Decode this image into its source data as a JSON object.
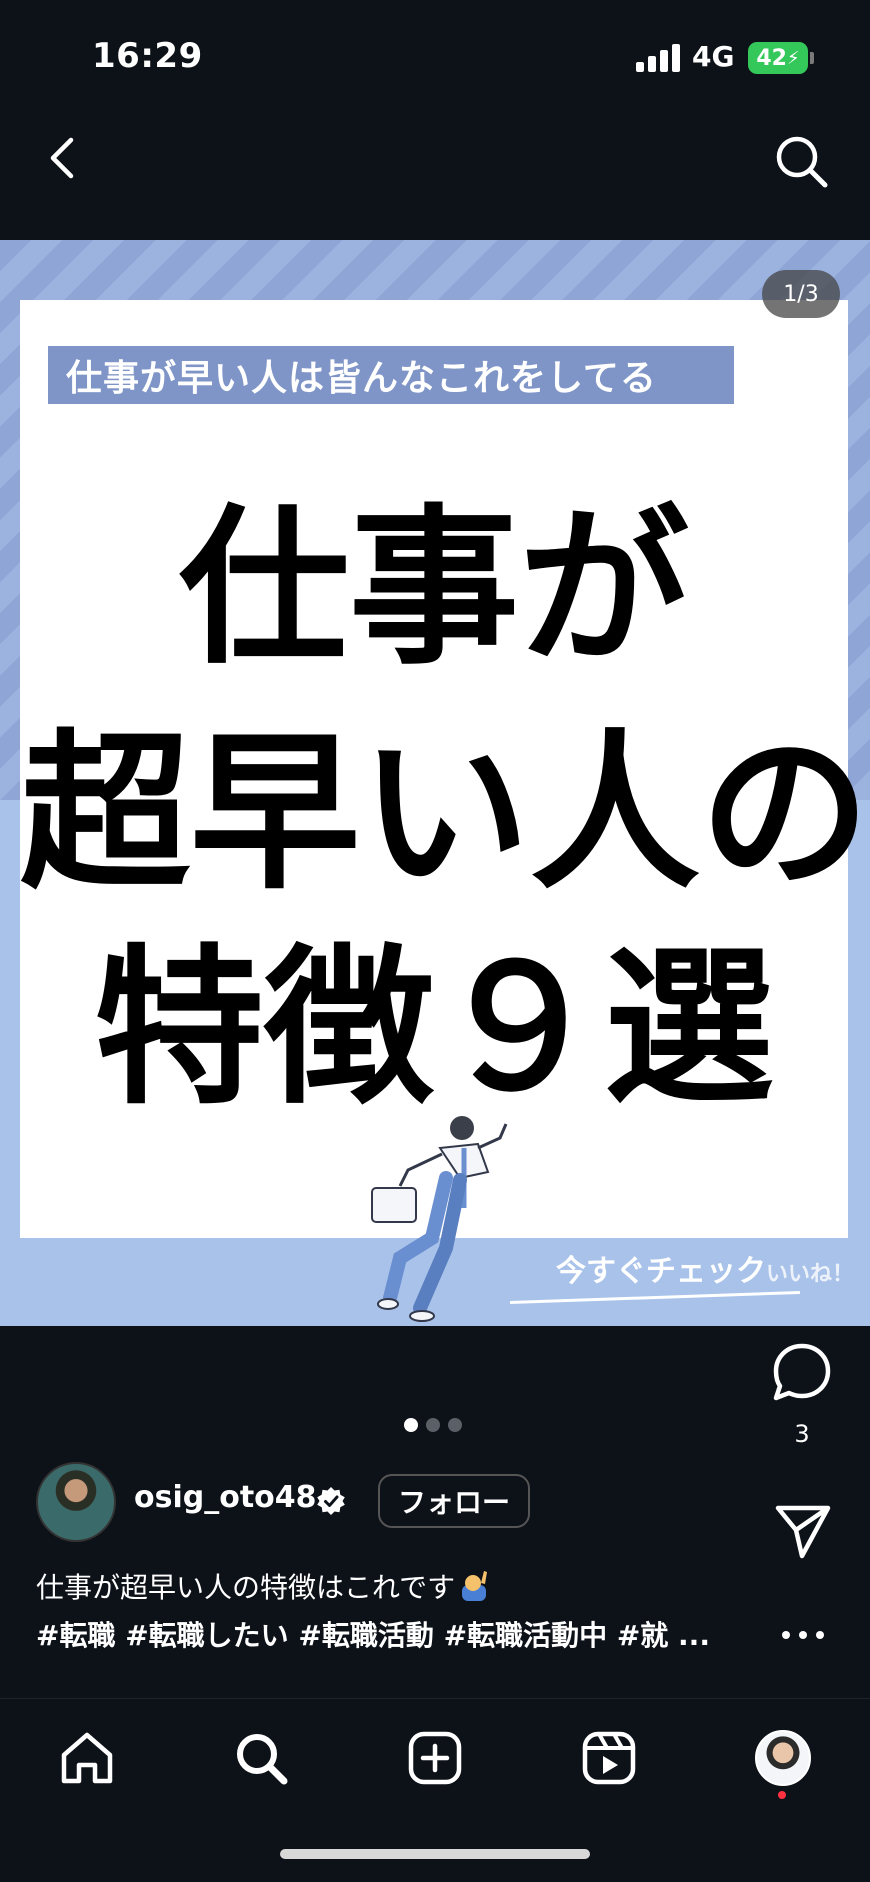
{
  "status_bar": {
    "time": "16:29",
    "network": "4G",
    "battery": "42"
  },
  "post": {
    "image": {
      "counter": "1/3",
      "subtitle": "仕事が早い人は皆んなこれをしてる",
      "headline_line1": "仕事が",
      "headline_line2": "超早い人の",
      "headline_line3": "特徴９選",
      "cta": "今すぐチェック",
      "cta_overlay": "いいね！"
    },
    "comment_count": "3",
    "carousel": {
      "total": 3,
      "active": 1
    },
    "user": {
      "username": "osig_oto48",
      "follow_label": "フォロー"
    },
    "caption": "仕事が超早い人の特徴はこれです",
    "hashtags": "#転職 #転職したい #転職活動 #転職活動中 #就 ..."
  },
  "icons": {
    "back": "chevron-left-icon",
    "search": "search-icon",
    "like": "heart-icon",
    "comment": "comment-icon",
    "share": "send-icon",
    "more": "more-icon",
    "verified": "verified-badge-icon",
    "nav": [
      "home-icon",
      "search-icon",
      "create-icon",
      "reels-icon",
      "profile-avatar"
    ]
  },
  "colors": {
    "background": "#0d1118",
    "accent_blue": "#7f95c7",
    "battery": "#34c759",
    "notification": "#ff3040"
  }
}
